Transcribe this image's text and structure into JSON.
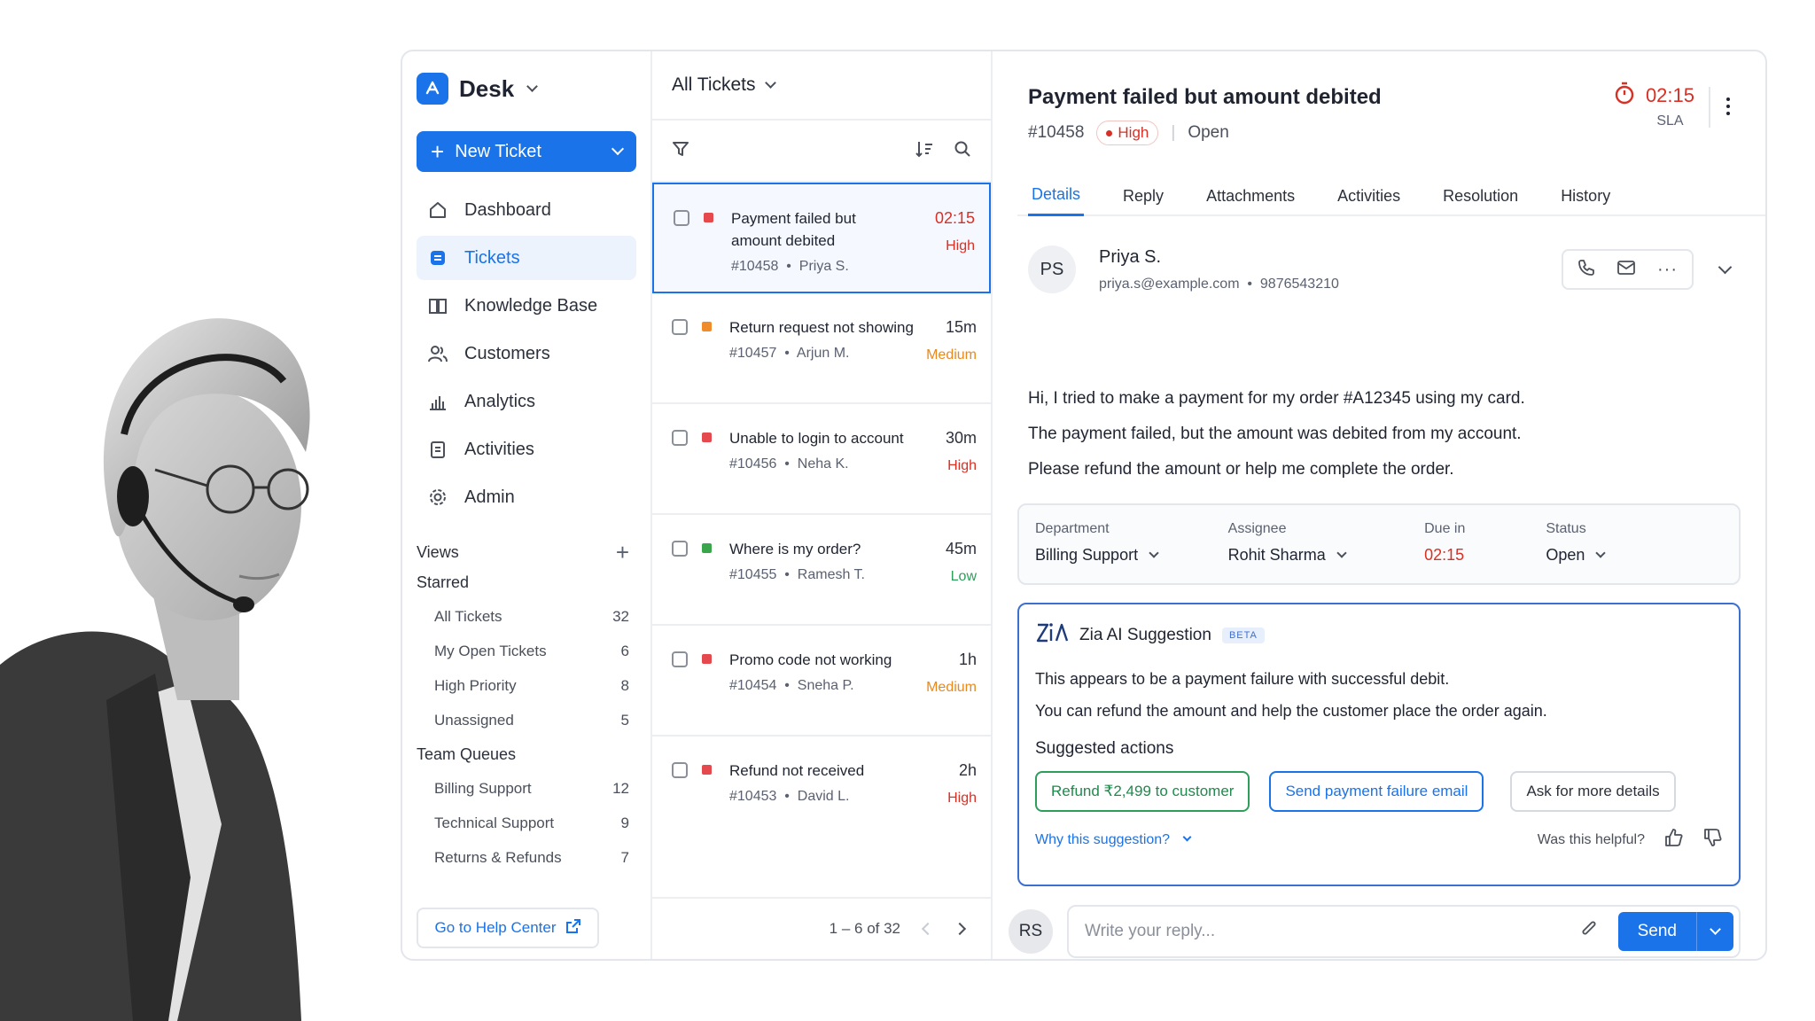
{
  "app": {
    "name": "Desk"
  },
  "sidebar": {
    "new_ticket_label": "New Ticket",
    "nav": [
      {
        "label": "Dashboard",
        "icon": "home-icon"
      },
      {
        "label": "Tickets",
        "icon": "ticket-icon",
        "active": true
      },
      {
        "label": "Knowledge Base",
        "icon": "book-icon"
      },
      {
        "label": "Customers",
        "icon": "users-icon"
      },
      {
        "label": "Analytics",
        "icon": "bar-chart-icon"
      },
      {
        "label": "Activities",
        "icon": "clipboard-icon"
      },
      {
        "label": "Admin",
        "icon": "gear-icon"
      }
    ],
    "views_label": "Views",
    "starred_label": "Starred",
    "starred": [
      {
        "label": "All Tickets",
        "count": "32"
      },
      {
        "label": "My Open Tickets",
        "count": "6"
      },
      {
        "label": "High Priority",
        "count": "8"
      },
      {
        "label": "Unassigned",
        "count": "5"
      }
    ],
    "team_queues_label": "Team Queues",
    "queues": [
      {
        "label": "Billing Support",
        "count": "12"
      },
      {
        "label": "Technical Support",
        "count": "9"
      },
      {
        "label": "Returns & Refunds",
        "count": "7"
      }
    ],
    "help_center_label": "Go to Help Center"
  },
  "ticket_list": {
    "title": "All Tickets",
    "tickets": [
      {
        "title": "Payment failed but amount debited",
        "id": "#10458",
        "customer": "Priya S.",
        "time": "02:15",
        "priority": "High",
        "color": "#e5484d"
      },
      {
        "title": "Return request not showing",
        "id": "#10457",
        "customer": "Arjun M.",
        "time": "15m",
        "priority": "Medium",
        "color": "#f08c2b"
      },
      {
        "title": "Unable to login to account",
        "id": "#10456",
        "customer": "Neha K.",
        "time": "30m",
        "priority": "High",
        "color": "#e5484d"
      },
      {
        "title": "Where is my order?",
        "id": "#10455",
        "customer": "Ramesh T.",
        "time": "45m",
        "priority": "Low",
        "color": "#3aa64c"
      },
      {
        "title": "Promo code not working",
        "id": "#10454",
        "customer": "Sneha P.",
        "time": "1h",
        "priority": "Medium",
        "color": "#e5484d"
      },
      {
        "title": "Refund not received",
        "id": "#10453",
        "customer": "David L.",
        "time": "2h",
        "priority": "High",
        "color": "#e5484d"
      }
    ],
    "pagination": "1 – 6 of 32"
  },
  "detail": {
    "title": "Payment failed but amount debited",
    "id": "#10458",
    "priority": "High",
    "status": "Open",
    "sla_time": "02:15",
    "sla_label": "SLA",
    "tabs": [
      "Details",
      "Reply",
      "Attachments",
      "Activities",
      "Resolution",
      "History"
    ],
    "contact": {
      "initials": "PS",
      "name": "Priya S.",
      "email": "priya.s@example.com",
      "phone": "9876543210"
    },
    "message": [
      "Hi, I tried to make a payment for my order #A12345 using my card.",
      "The payment failed, but the amount was debited from my account.",
      "Please refund the amount or help me complete the order."
    ],
    "fields": {
      "department_label": "Department",
      "department": "Billing Support",
      "assignee_label": "Assignee",
      "assignee": "Rohit Sharma",
      "due_label": "Due in",
      "due": "02:15",
      "status_label": "Status",
      "status": "Open"
    },
    "zia": {
      "title": "Zia AI Suggestion",
      "badge": "BETA",
      "text": [
        "This appears to be a payment failure with successful debit.",
        "You can refund the amount and help the customer place the order again."
      ],
      "actions_title": "Suggested actions",
      "actions": [
        "Refund ₹2,499 to customer",
        "Send payment failure email",
        "Ask for more details"
      ],
      "why_label": "Why this suggestion?",
      "helpful_label": "Was this helpful?"
    },
    "reply": {
      "initials": "RS",
      "placeholder": "Write your reply...",
      "send_label": "Send"
    }
  },
  "colors": {
    "accent": "#1a73e8",
    "high": "#d93025",
    "medium": "#e8891c",
    "low": "#2e9e5b"
  }
}
